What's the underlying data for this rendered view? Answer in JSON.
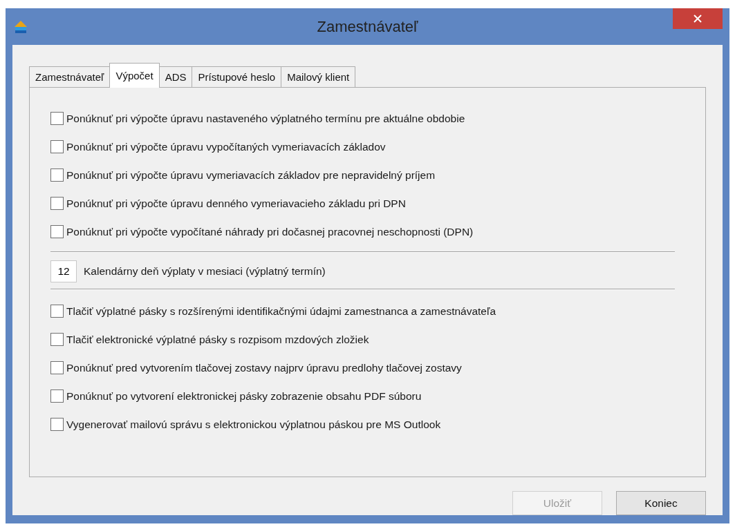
{
  "window": {
    "title": "Zamestnávateľ"
  },
  "tabs": [
    {
      "label": "Zamestnávateľ",
      "selected": false
    },
    {
      "label": "Výpočet",
      "selected": true
    },
    {
      "label": "ADS",
      "selected": false
    },
    {
      "label": "Prístupové heslo",
      "selected": false
    },
    {
      "label": "Mailový klient",
      "selected": false
    }
  ],
  "options_top": [
    {
      "label": "Ponúknuť pri výpočte úpravu nastaveného výplatného termínu pre aktuálne obdobie",
      "checked": false
    },
    {
      "label": "Ponúknuť pri výpočte úpravu vypočítaných vymeriavacích základov",
      "checked": false
    },
    {
      "label": "Ponúknuť pri výpočte úpravu vymeriavacích základov pre nepravidelný príjem",
      "checked": false
    },
    {
      "label": "Ponúknuť pri výpočte úpravu denného vymeriavacieho základu pri DPN",
      "checked": false
    },
    {
      "label": "Ponúknuť pri výpočte vypočítané náhrady pri dočasnej pracovnej neschopnosti (DPN)",
      "checked": false
    }
  ],
  "pay_day": {
    "value": "12",
    "label": "Kalendárny deň výplaty v mesiaci (výplatný termín)"
  },
  "options_bottom": [
    {
      "label": "Tlačiť výplatné pásky s rozšírenými identifikačnými údajmi zamestnanca a zamestnávateľa",
      "checked": false
    },
    {
      "label": "Tlačiť elektronické výplatné pásky s rozpisom mzdových zložiek",
      "checked": false
    },
    {
      "label": "Ponúknuť pred vytvorením tlačovej zostavy najprv úpravu predlohy tlačovej zostavy",
      "checked": false
    },
    {
      "label": "Ponúknuť po vytvorení elektronickej pásky zobrazenie obsahu PDF súboru",
      "checked": false
    },
    {
      "label": "Vygenerovať mailovú správu s elektronickou výplatnou páskou pre MS Outlook",
      "checked": false
    }
  ],
  "buttons": [
    {
      "label": "Uložiť",
      "disabled": true
    },
    {
      "label": "Koniec",
      "disabled": false
    }
  ]
}
